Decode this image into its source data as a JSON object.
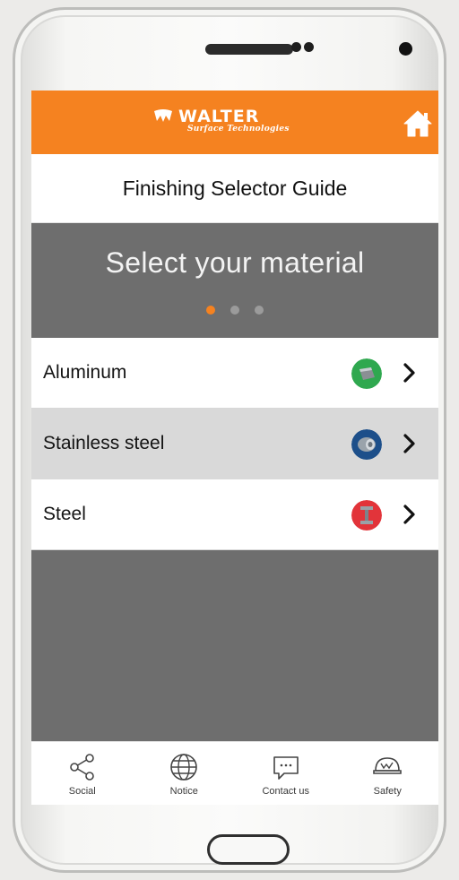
{
  "app": {
    "brand_name": "WALTER",
    "brand_tagline": "Surface Technologies",
    "page_title": "Finishing Selector Guide"
  },
  "hero": {
    "title": "Select your material",
    "pager": {
      "count": 3,
      "active_index": 0
    }
  },
  "materials": [
    {
      "label": "Aluminum",
      "icon": "aluminum-icon",
      "color": "#2fa84f"
    },
    {
      "label": "Stainless steel",
      "icon": "stainless-steel-icon",
      "color": "#1d4f8a"
    },
    {
      "label": "Steel",
      "icon": "steel-icon",
      "color": "#e2343a"
    }
  ],
  "tabs": [
    {
      "label": "Social",
      "icon": "share-icon"
    },
    {
      "label": "Notice",
      "icon": "globe-icon"
    },
    {
      "label": "Contact us",
      "icon": "chat-icon"
    },
    {
      "label": "Safety",
      "icon": "helmet-icon"
    }
  ],
  "colors": {
    "accent": "#f58220",
    "hero_bg": "#6e6e6e",
    "row_shaded": "#d9d9d9"
  }
}
